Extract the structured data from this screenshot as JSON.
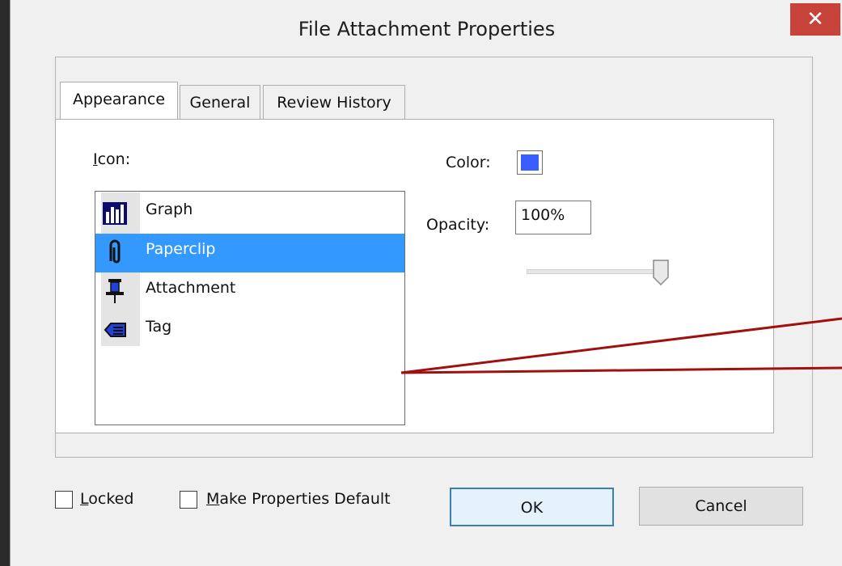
{
  "window": {
    "title": "File Attachment Properties",
    "close_symbol": "✕"
  },
  "tabs": [
    {
      "label": "Appearance",
      "active": true
    },
    {
      "label": "General",
      "active": false
    },
    {
      "label": "Review History",
      "active": false
    }
  ],
  "appearance": {
    "icon_label": "Icon:",
    "icons": [
      {
        "label": "Graph",
        "icon": "graph-icon",
        "selected": false
      },
      {
        "label": "Paperclip",
        "icon": "paperclip-icon",
        "selected": true
      },
      {
        "label": "Attachment",
        "icon": "pushpin-icon",
        "selected": false
      },
      {
        "label": "Tag",
        "icon": "tag-icon",
        "selected": false
      }
    ],
    "color_label": "Color:",
    "color_value": "#3b5cff",
    "opacity_label": "Opacity:",
    "opacity_value": "100%",
    "opacity_slider_fraction": 1.0
  },
  "footer": {
    "locked_label": "Locked",
    "locked_checked": false,
    "make_default_label": "Make Properties Default",
    "make_default_checked": false,
    "ok_label": "OK",
    "cancel_label": "Cancel"
  },
  "colors": {
    "selection": "#3399ff",
    "close_button": "#c7433a",
    "callout_line": "#a01010"
  }
}
